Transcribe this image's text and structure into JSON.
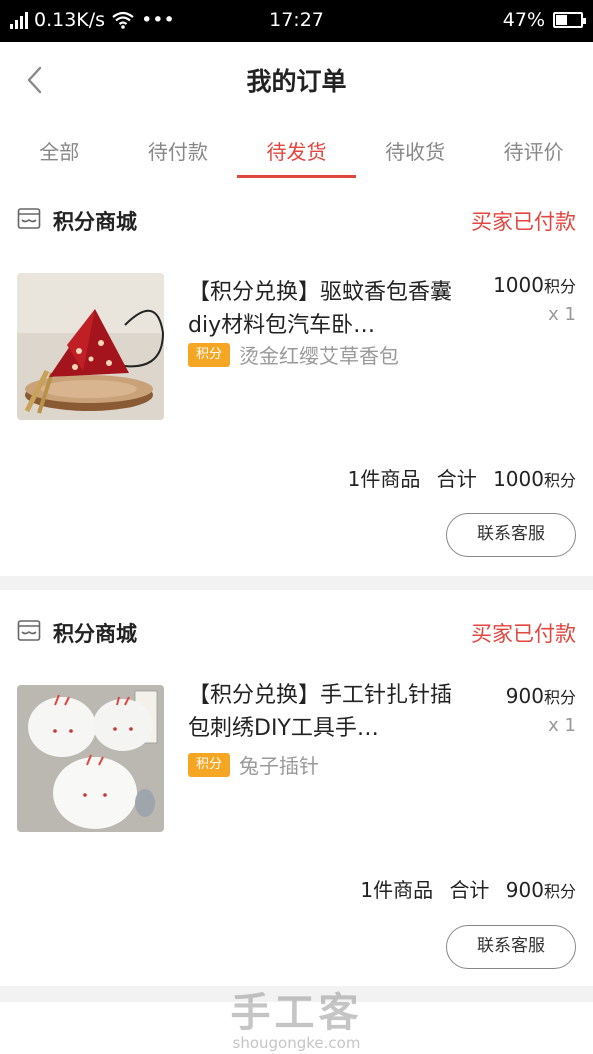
{
  "status_bar": {
    "network_speed": "0.13K/s",
    "dots": "•••",
    "time": "17:27",
    "battery": "47%",
    "battery_level": 0.47
  },
  "header": {
    "title": "我的订单"
  },
  "tabs": [
    {
      "label": "全部"
    },
    {
      "label": "待付款"
    },
    {
      "label": "待发货",
      "active": true
    },
    {
      "label": "待收货"
    },
    {
      "label": "待评价"
    }
  ],
  "orders": [
    {
      "shop_name": "积分商城",
      "status": "买家已付款",
      "product_title": "【积分兑换】驱蚊香包香囊diy材料包汽车卧…",
      "price": "1000",
      "price_unit": "积分",
      "qty": "x 1",
      "badge": "积分",
      "variant": "烫金红缨艾草香包",
      "summary_count": "1件商品",
      "summary_total_label": "合计",
      "summary_total": "1000",
      "summary_unit": "积分",
      "button": "联系客服"
    },
    {
      "shop_name": "积分商城",
      "status": "买家已付款",
      "product_title": "【积分兑换】手工针扎针插包刺绣DIY工具手…",
      "price": "900",
      "price_unit": "积分",
      "qty": "x 1",
      "badge": "积分",
      "variant": "兔子插针",
      "summary_count": "1件商品",
      "summary_total_label": "合计",
      "summary_total": "900",
      "summary_unit": "积分",
      "button": "联系客服"
    }
  ],
  "watermark": {
    "text": "手工客",
    "url": "shougongke.com"
  },
  "colors": {
    "accent": "#e2463f",
    "badge": "#f5a623",
    "divider": "#f2f2f2"
  }
}
